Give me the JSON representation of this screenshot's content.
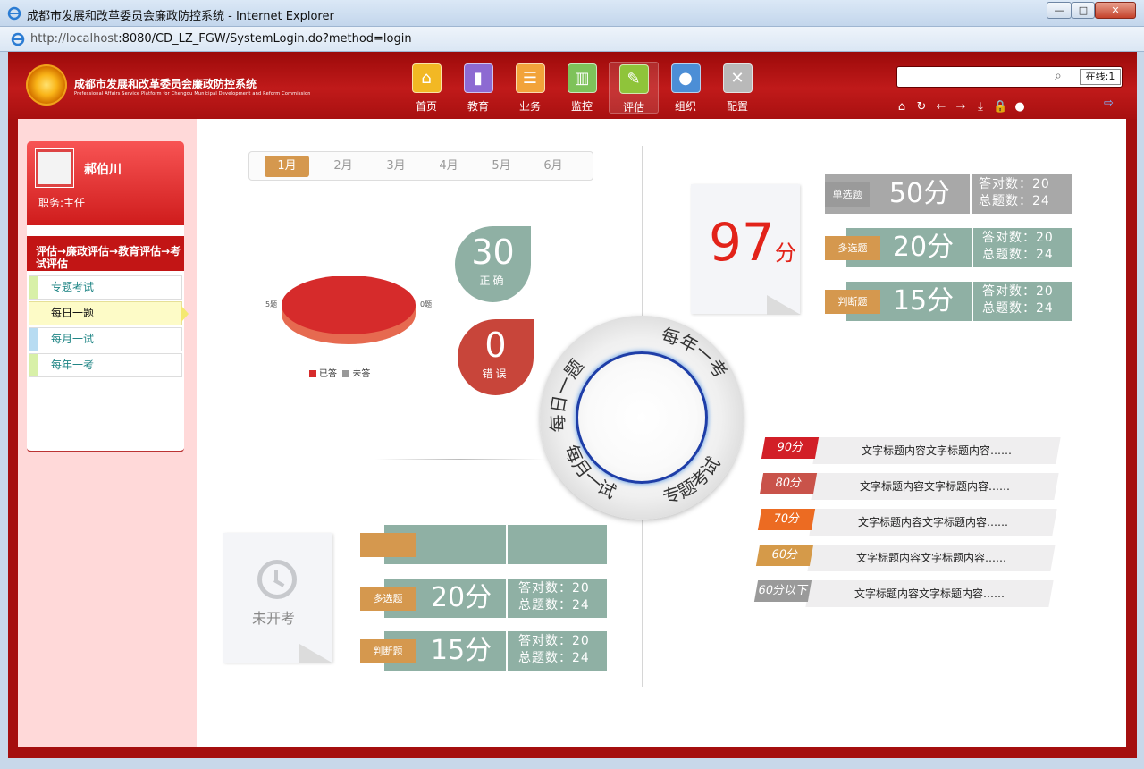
{
  "window": {
    "title": "成都市发展和改革委员会廉政防控系统 - Internet Explorer",
    "url_host": "http://localhost",
    "url_path": ":8080/CD_LZ_FGW/SystemLogin.do?method=login",
    "min_label": "—",
    "max_label": "□",
    "close_label": "✕"
  },
  "header": {
    "title_cn": "成都市发展和改革委员会廉政防控系统",
    "title_en": "Professional Affairs Service Platform for Chengdu Municipal Development and Reform Commission",
    "nav": [
      {
        "label": "首页",
        "icon": "home-icon",
        "glyph": "⌂",
        "color": "#f2b824"
      },
      {
        "label": "教育",
        "icon": "book-icon",
        "glyph": "▮",
        "color": "#8d6ad2"
      },
      {
        "label": "业务",
        "icon": "list-icon",
        "glyph": "☰",
        "color": "#f2a33a"
      },
      {
        "label": "监控",
        "icon": "chart-icon",
        "glyph": "▥",
        "color": "#7ec25a"
      },
      {
        "label": "评估",
        "icon": "edit-icon",
        "glyph": "✎",
        "color": "#8fc43a"
      },
      {
        "label": "组织",
        "icon": "user-icon",
        "glyph": "●",
        "color": "#4c8ed6"
      },
      {
        "label": "配置",
        "icon": "tools-icon",
        "glyph": "✕",
        "color": "#b9b9b9"
      }
    ],
    "search_placeholder": "",
    "online_label": "在线:1",
    "tools": [
      "⌂",
      "↻",
      "←",
      "→",
      "⤓",
      "🔒",
      "●"
    ],
    "exit_glyph": "⇨"
  },
  "sidebar": {
    "name": "郝伯川",
    "role": "职务:主任",
    "breadcrumb": "评估→廉政评估→教育评估→考试评估",
    "menu": [
      {
        "label": "专题考试"
      },
      {
        "label": "每日一题"
      },
      {
        "label": "每月一试"
      },
      {
        "label": "每年一考"
      }
    ]
  },
  "months": [
    "1月",
    "2月",
    "3月",
    "4月",
    "5月",
    "6月"
  ],
  "pie": {
    "left_label": "5题",
    "right_label": "0题",
    "legend": [
      {
        "label": "已答",
        "color": "#d62b2b"
      },
      {
        "label": "未答",
        "color": "#999999"
      }
    ]
  },
  "correct": {
    "value": "30",
    "label": "正确"
  },
  "wrong": {
    "value": "0",
    "label": "错误"
  },
  "total_score": {
    "value": "97",
    "unit": "分"
  },
  "results": [
    {
      "type": "单选题",
      "score": "50分",
      "correct": "答对数：20",
      "total": "总题数：24"
    },
    {
      "type": "多选题",
      "score": "20分",
      "correct": "答对数：20",
      "total": "总题数：24"
    },
    {
      "type": "判断题",
      "score": "15分",
      "correct": "答对数：20",
      "total": "总题数：24"
    }
  ],
  "ring_labels": {
    "daily": "每日一题",
    "yearly": "每年一考",
    "monthly": "每月一试",
    "special": "专题考试"
  },
  "ranking": [
    {
      "badge": "90分",
      "color": "#d21f27",
      "text": "文字标题内容文字标题内容……"
    },
    {
      "badge": "80分",
      "color": "#c9534a",
      "text": "文字标题内容文字标题内容……"
    },
    {
      "badge": "70分",
      "color": "#ec6b22",
      "text": "文字标题内容文字标题内容……"
    },
    {
      "badge": "60分",
      "color": "#d59a49",
      "text": "文字标题内容文字标题内容……"
    },
    {
      "badge": "60分以下",
      "color": "#9a9a9a",
      "text": "文字标题内容文字标题内容……"
    }
  ],
  "pending": {
    "label": "未开考",
    "rows": [
      {
        "type": "",
        "score": "",
        "correct": "",
        "total": ""
      },
      {
        "type": "多选题",
        "score": "20分",
        "correct": "答对数：20",
        "total": "总题数：24"
      },
      {
        "type": "判断题",
        "score": "15分",
        "correct": "答对数：20",
        "total": "总题数：24"
      }
    ]
  }
}
